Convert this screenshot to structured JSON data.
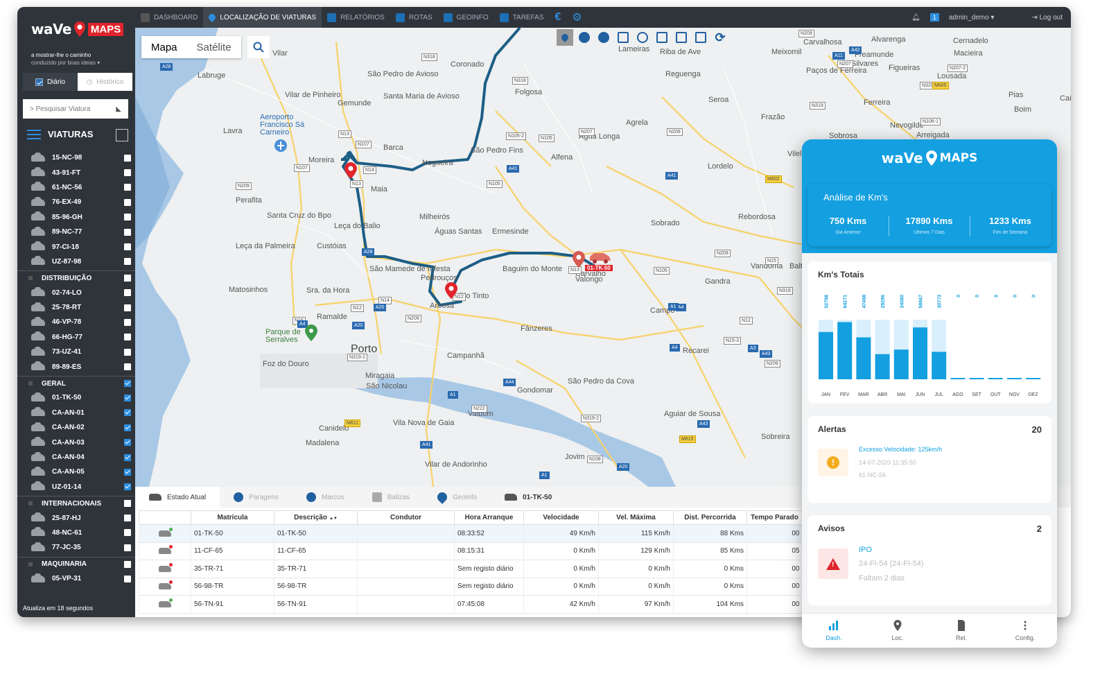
{
  "brand": {
    "name_left": "waVe",
    "name_right": "MAPS",
    "tagline1": "a mostrar-lhe o caminho",
    "tagline2": "conduzido por boas ideias"
  },
  "mode": {
    "diario": "Diário",
    "historico": "Histórico"
  },
  "search": {
    "placeholder": "> Pesquisar Viatura"
  },
  "viaturas": {
    "title": "VIATURAS"
  },
  "vehicle_groups": [
    {
      "name": "",
      "checked": false,
      "items": [
        "15-NC-98",
        "43-91-FT",
        "61-NC-56",
        "76-EX-49",
        "85-96-GH",
        "89-NC-77",
        "97-CI-18",
        "UZ-87-98"
      ]
    },
    {
      "name": "DISTRIBUIÇÃO",
      "checked": false,
      "items": [
        "02-74-LO",
        "25-78-RT",
        "46-VP-78",
        "66-HG-77",
        "73-UZ-41",
        "89-89-ES"
      ]
    },
    {
      "name": "GERAL",
      "checked": true,
      "items": [
        "01-TK-50",
        "CA-AN-01",
        "CA-AN-02",
        "CA-AN-03",
        "CA-AN-04",
        "CA-AN-05",
        "UZ-01-14"
      ]
    },
    {
      "name": "INTERNACIONAIS",
      "checked": false,
      "items": [
        "25-87-HJ",
        "48-NC-61",
        "77-JC-35"
      ]
    },
    {
      "name": "MAQUINARIA",
      "checked": false,
      "items": [
        "05-VP-31"
      ]
    }
  ],
  "update_text": "Atualiza em 18 segundos",
  "topnav": {
    "items": [
      "DASHBOARD",
      "LOCALIZAÇÃO DE VIATURAS",
      "RELATÓRIOS",
      "ROTAS",
      "GEOINFO",
      "TAREFAS"
    ],
    "active": 1,
    "notif_count": "1",
    "user": "admin_demo",
    "logout": "Log out",
    "euro": "€"
  },
  "map": {
    "tab_map": "Mapa",
    "tab_sat": "Satélite",
    "vehicle_label": "01-TK-50",
    "places": [
      "Vilar",
      "Labruge",
      "São Pedro de Avioso",
      "Coronado",
      "Santa Maria de Avioso",
      "Folgosa",
      "Vilar de Pinheiro",
      "Gemunde",
      "Aeroporto Francisco Sá Carneiro",
      "Lavra",
      "Moreira",
      "Barca",
      "Nogueira",
      "São Pedro Fins",
      "Alfena",
      "Água Longa",
      "Agrela",
      "Maia",
      "Perafita",
      "Santa Cruz do Bpo",
      "Leça do Balio",
      "Milheirós",
      "Águas Santas",
      "Ermesinde",
      "Custóias",
      "Leça da Palmeira",
      "São Mamede de Infesta",
      "Pedrouços",
      "Rio Tinto",
      "Baguim do Monte",
      "Valongo",
      "Matosinhos",
      "Sra. da Hora",
      "Ramalde",
      "Parque de Serralves",
      "Porto",
      "Foz do Douro",
      "Campanhã",
      "Fânzeres",
      "Miragaia",
      "São Nicolau",
      "Gondomar",
      "São Pedro da Cova",
      "Valbom",
      "Vila Nova de Gaia",
      "Canidelo",
      "Madalena",
      "Vilar de Andorinho",
      "Jovim",
      "Aguiar de Sousa",
      "Sobreira",
      "Campo",
      "Recarei",
      "Sobrado",
      "Rebordosa",
      "Vandoma",
      "Baltar",
      "Gandra",
      "Lordelo",
      "Seroa",
      "Frazão",
      "Reguenga",
      "Riba de Ave",
      "Lameiras",
      "Meixomil",
      "Carvalhosa",
      "Freamunde",
      "Alvarenga",
      "Silvares",
      "Figueiras",
      "Paços de Ferreira",
      "Lousada",
      "Macieira",
      "Cernadelo",
      "Ferreira",
      "Pias",
      "Caíde de",
      "Boim",
      "Nevogilde",
      "Sobrosa",
      "Arreigada",
      "Vilela",
      "Areosa",
      "Carvalho"
    ],
    "roads": [
      "N209",
      "A42",
      "A11",
      "N318",
      "N207",
      "N207-2",
      "N318",
      "N320",
      "M605",
      "N319",
      "N106-1",
      "N105-2",
      "N105",
      "N207",
      "N209",
      "A28",
      "N13",
      "N107",
      "N14",
      "N107",
      "N13",
      "A41",
      "N105",
      "N209",
      "A41",
      "M602",
      "A41",
      "N209",
      "A28",
      "N13",
      "N105",
      "N15",
      "M595",
      "N319",
      "N209",
      "N13",
      "N12",
      "N14",
      "N12",
      "A20",
      "A20",
      "N209",
      "N15",
      "A4",
      "A4",
      "N12",
      "A4",
      "N15-3",
      "A3",
      "A1",
      "N319-2",
      "N209",
      "A43",
      "A44",
      "A1",
      "N222",
      "M611",
      "A41",
      "N319-2",
      "A43",
      "M615",
      "N108",
      "A20",
      "A1"
    ]
  },
  "bottom": {
    "tabs": [
      "Estado Atual",
      "Paragens",
      "Marcos",
      "Balizas",
      "Geoinfo",
      "01-TK-50"
    ],
    "columns": [
      "Matricula",
      "Descrição",
      "Condutor",
      "Hora Arranque",
      "Velocidade",
      "Vel. Máxima",
      "Dist. Percorrida",
      "Tempo Parado"
    ],
    "sort_icon": "▲▼",
    "rows": [
      {
        "status": "green",
        "mat": "01-TK-50",
        "desc": "01-TK-50",
        "cond": "",
        "hora": "08:33:52",
        "vel": "49 Km/h",
        "vmax": "115 Km/h",
        "dist": "88 Kms",
        "tempo": "00"
      },
      {
        "status": "red",
        "mat": "11-CF-65",
        "desc": "11-CF-65",
        "cond": "",
        "hora": "08:15:31",
        "vel": "0 Km/h",
        "vmax": "129 Km/h",
        "dist": "85 Kms",
        "tempo": "05"
      },
      {
        "status": "red",
        "mat": "35-TR-71",
        "desc": "35-TR-71",
        "cond": "",
        "hora": "Sem registo diário",
        "vel": "0 Km/h",
        "vmax": "0 Km/h",
        "dist": "0 Kms",
        "tempo": "00"
      },
      {
        "status": "red",
        "mat": "56-98-TR",
        "desc": "56-98-TR",
        "cond": "",
        "hora": "Sem registo diário",
        "vel": "0 Km/h",
        "vmax": "0 Km/h",
        "dist": "0 Kms",
        "tempo": "00"
      },
      {
        "status": "green",
        "mat": "56-TN-91",
        "desc": "56-TN-91",
        "cond": "",
        "hora": "07:45:08",
        "vel": "42 Km/h",
        "vmax": "97 Km/h",
        "dist": "104 Kms",
        "tempo": "00"
      }
    ]
  },
  "phone": {
    "kms": {
      "title": "Análise de Km's",
      "cols": [
        {
          "v": "750 Kms",
          "s": "Dia Anterior"
        },
        {
          "v": "17890 Kms",
          "s": "Ultimos 7 Dias"
        },
        {
          "v": "1233 Kms",
          "s": "Fim de Semana"
        }
      ]
    },
    "totais": {
      "title": "Km's Totais"
    },
    "alertas": {
      "title": "Alertas",
      "count": "20",
      "text": "Excesso Velocidade: 125km/h",
      "date": "14-07-2020 11:35:50",
      "plate": "61-NC-56",
      "icon": "!"
    },
    "avisos": {
      "title": "Avisos",
      "count": "2",
      "text": "IPO",
      "plate": "24-FI-54 (24-FI-54)",
      "sub": "Faltam 2 dias",
      "icon": "!"
    },
    "nav": [
      "Dash.",
      "Loc.",
      "Rel.",
      "Config."
    ]
  },
  "chart_data": {
    "type": "bar",
    "title": "Km's Totais",
    "categories": [
      "JAN",
      "FEV",
      "MAR",
      "ABR",
      "MAI",
      "JUN",
      "JUL",
      "AGO",
      "SET",
      "OUT",
      "NOV",
      "DEZ"
    ],
    "values": [
      52798,
      64271,
      47498,
      29296,
      34080,
      58667,
      30773,
      0,
      0,
      0,
      0,
      0
    ],
    "bar_fraction": [
      0.62,
      0.75,
      0.55,
      0.33,
      0.39,
      0.68,
      0.36,
      0,
      0,
      0,
      0,
      0
    ],
    "colors": {
      "bar": "#139fe0",
      "bar_bg": "#d9effc"
    }
  },
  "colors": {
    "accent": "#2c8ee0",
    "brand_red": "#e0242b",
    "phone_blue": "#139fe0",
    "route": "#1d5e86"
  }
}
